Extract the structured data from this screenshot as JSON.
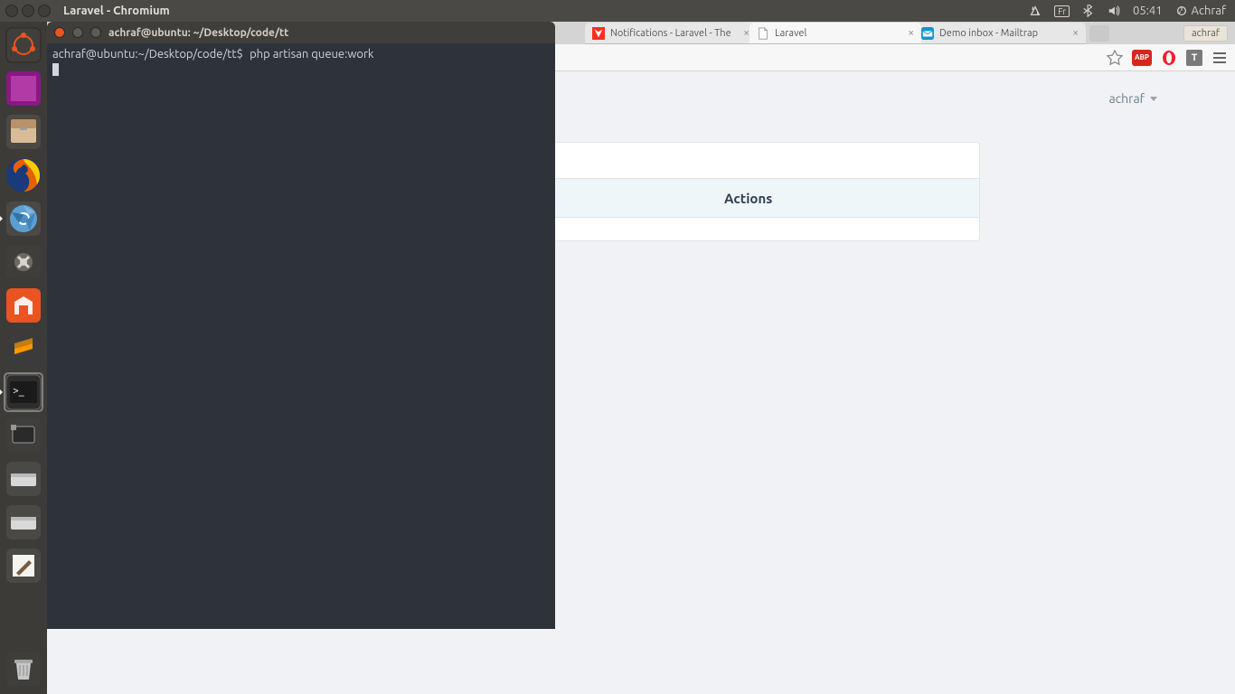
{
  "topbar": {
    "window_title": "Laravel - Chromium",
    "keyboard": "Fr",
    "time": "05:41",
    "user": "Achraf"
  },
  "launcher": {
    "items": [
      {
        "name": "dash",
        "active": false
      },
      {
        "name": "workspace",
        "active": false
      },
      {
        "name": "files",
        "active": false
      },
      {
        "name": "firefox",
        "active": false
      },
      {
        "name": "chromium",
        "active": true
      },
      {
        "name": "settings",
        "active": false
      },
      {
        "name": "software",
        "active": false
      },
      {
        "name": "sublime",
        "active": false
      },
      {
        "name": "terminal",
        "active": true
      },
      {
        "name": "screenshot",
        "active": false
      },
      {
        "name": "disk1",
        "active": false
      },
      {
        "name": "disk2",
        "active": false
      },
      {
        "name": "textedit",
        "active": false
      }
    ],
    "trash": "trash"
  },
  "browser": {
    "tabs": [
      {
        "label": "Notifications - Laravel - The",
        "active": false,
        "favicon": "laravel"
      },
      {
        "label": "Laravel",
        "active": true,
        "favicon": "page"
      },
      {
        "label": "Demo inbox - Mailtrap",
        "active": false,
        "favicon": "mailtrap"
      }
    ],
    "user_chip": "achraf",
    "ext_abp": "ABP",
    "ext_opera": "O",
    "ext_t": "T"
  },
  "page": {
    "user": "achraf",
    "columns": {
      "actions": "Actions"
    }
  },
  "terminal": {
    "title": "achraf@ubuntu: ~/Desktop/code/tt",
    "prompt": "achraf@ubuntu:~/Desktop/code/tt$",
    "command": "php artisan queue:work"
  }
}
